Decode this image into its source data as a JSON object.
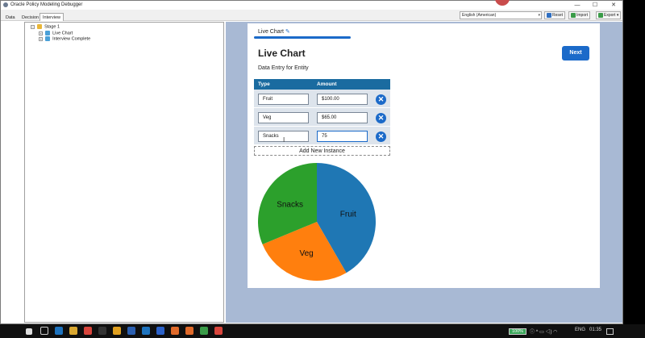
{
  "window": {
    "title": "Oracle Policy Modeling Debugger",
    "controls": {
      "minimize": "—",
      "maximize": "☐",
      "close": "✕"
    }
  },
  "toolbar": {
    "tabs": [
      {
        "label": "Data"
      },
      {
        "label": "Decision"
      },
      {
        "label": "Interview"
      }
    ],
    "active_tab": "Interview",
    "language": "English (American)",
    "reset_label": "Reset",
    "import_label": "Import",
    "export_label": "Export ▾"
  },
  "tree": {
    "root": {
      "label": "Stage 1",
      "expander": "−"
    },
    "children": [
      {
        "label": "Live Chart",
        "expander": "+"
      },
      {
        "label": "Interview Complete",
        "expander": "+"
      }
    ]
  },
  "interview": {
    "breadcrumb": "Live Chart",
    "page_title": "Live Chart",
    "next_label": "Next",
    "subtitle": "Data Entry for Entity",
    "table": {
      "headers": {
        "type": "Type",
        "amount": "Amount"
      },
      "rows": [
        {
          "type": "Fruit",
          "amount": "$100.00"
        },
        {
          "type": "Veg",
          "amount": "$65.00"
        },
        {
          "type": "Snacks",
          "amount": "75"
        }
      ],
      "delete_symbol": "✕",
      "add_label": "Add New Instance"
    }
  },
  "chart_data": {
    "type": "pie",
    "categories": [
      "Fruit",
      "Veg",
      "Snacks"
    ],
    "values": [
      100,
      65,
      75
    ],
    "colors": [
      "#1f77b4",
      "#ff7f0e",
      "#2ca02c"
    ]
  },
  "taskbar": {
    "battery": "100%",
    "language": "ENG",
    "clock": "01:35"
  }
}
